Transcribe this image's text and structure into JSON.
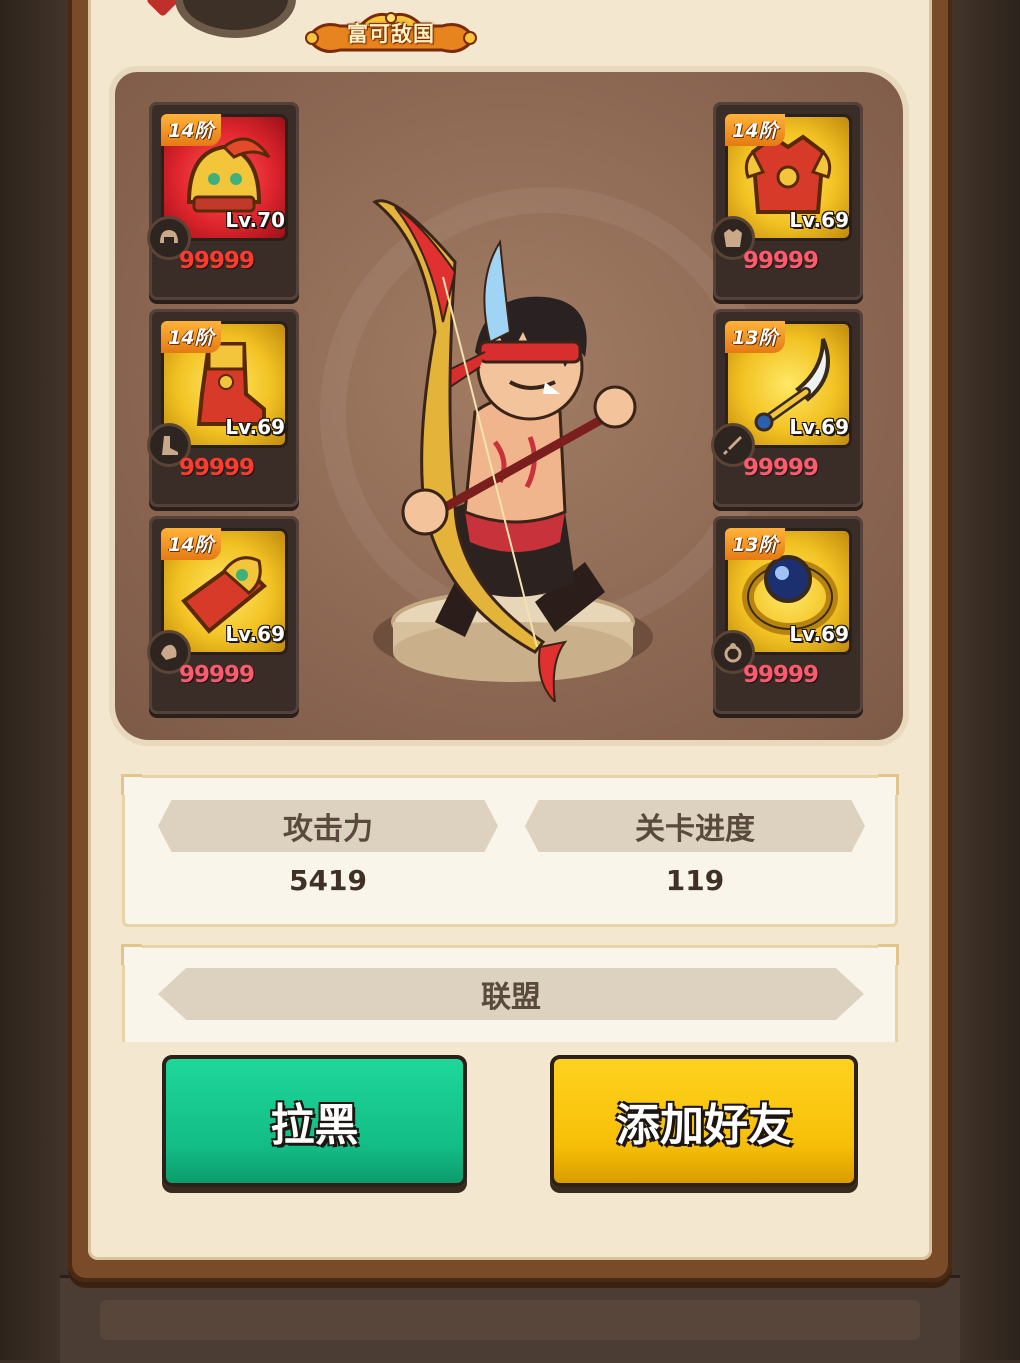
{
  "title": "富可敌国",
  "equipment_left": [
    {
      "tier": "14阶",
      "level": "Lv.70",
      "stars": "99999",
      "frame": "red",
      "slot_icon": "helmet-icon"
    },
    {
      "tier": "14阶",
      "level": "Lv.69",
      "stars": "99999",
      "frame": "gold",
      "slot_icon": "boots-icon"
    },
    {
      "tier": "14阶",
      "level": "Lv.69",
      "stars": "99999",
      "frame": "gold",
      "slot_icon": "bracer-icon"
    }
  ],
  "equipment_right": [
    {
      "tier": "14阶",
      "level": "Lv.69",
      "stars": "99999",
      "frame": "gold",
      "slot_icon": "armor-icon"
    },
    {
      "tier": "13阶",
      "level": "Lv.69",
      "stars": "99999",
      "frame": "gold",
      "slot_icon": "weapon-icon"
    },
    {
      "tier": "13阶",
      "level": "Lv.69",
      "stars": "99999",
      "frame": "gold",
      "slot_icon": "ring-icon"
    }
  ],
  "stats": {
    "attack_label": "攻击力",
    "attack_value": "5419",
    "progress_label": "关卡进度",
    "progress_value": "119"
  },
  "alliance": {
    "label": "联盟"
  },
  "buttons": {
    "block_label": "拉黑",
    "add_friend_label": "添加好友"
  },
  "colors": {
    "panel": "#f3e7cf",
    "frame": "#7a4b28",
    "green_button": "#12bd86",
    "yellow_button": "#f6bf07",
    "tier_badge": "#e57a13"
  }
}
